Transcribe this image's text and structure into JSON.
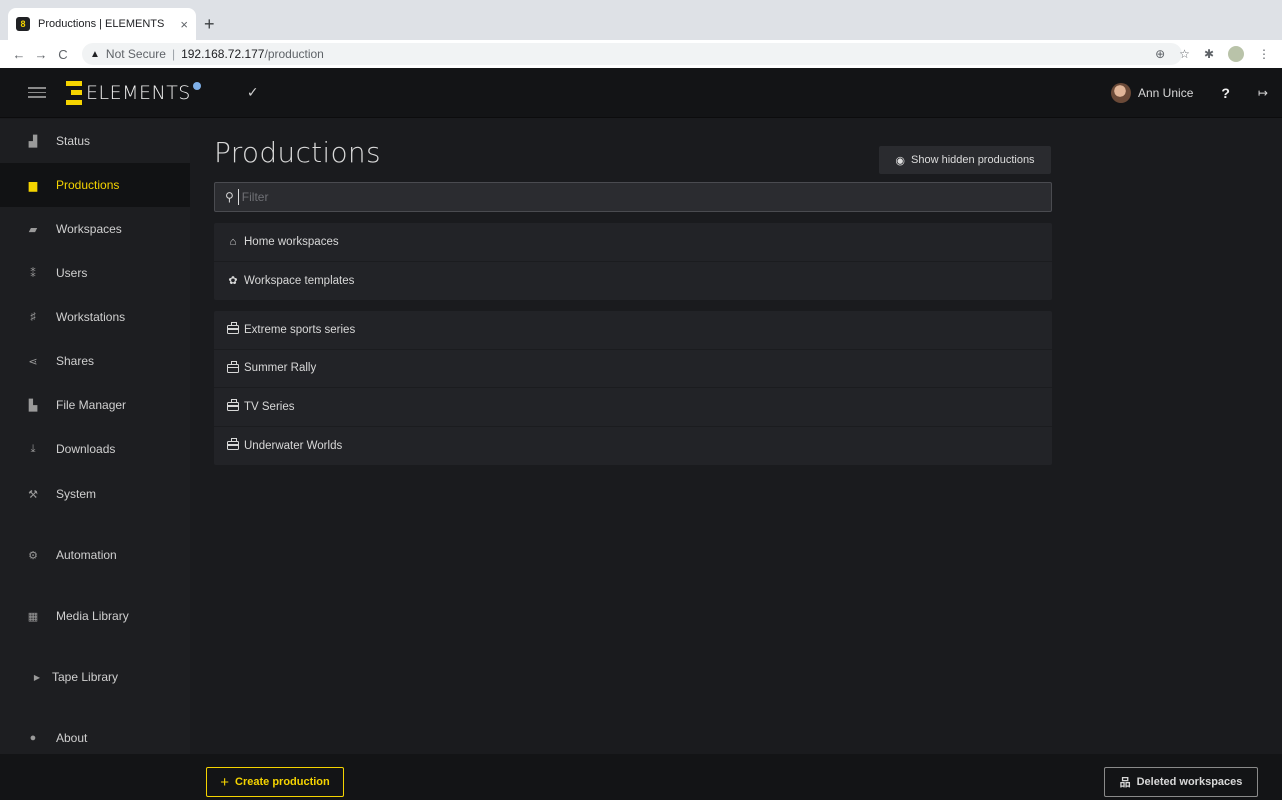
{
  "browser": {
    "tab_title": "Productions | ELEMENTS",
    "favicon_letter": "8",
    "close_glyph": "×",
    "newtab_glyph": "+",
    "back_glyph": "←",
    "forward_glyph": "→",
    "reload_glyph": "C",
    "security_warning": "▲",
    "security_label": "Not Secure",
    "url_host": "192.168.72.177",
    "url_path": "/production",
    "zoom_glyph": "⊕",
    "bookmark_glyph": "☆",
    "extensions_glyph": "✱",
    "menu_glyph": "⋮"
  },
  "header": {
    "logo_text": "ELEMENTS",
    "check_glyph": "✓",
    "user_name": "Ann Unice",
    "help_glyph": "?",
    "logout_glyph": "↦"
  },
  "sidebar": {
    "items": [
      {
        "label": "Status",
        "icon": "area-chart-icon",
        "glyph": "▟"
      },
      {
        "label": "Productions",
        "icon": "briefcase-icon",
        "glyph": "▆"
      },
      {
        "label": "Workspaces",
        "icon": "folder-open-icon",
        "glyph": "▰"
      },
      {
        "label": "Users",
        "icon": "users-icon",
        "glyph": "⁑"
      },
      {
        "label": "Workstations",
        "icon": "sitemap-icon",
        "glyph": "♯"
      },
      {
        "label": "Shares",
        "icon": "share-icon",
        "glyph": "⋖"
      },
      {
        "label": "File Manager",
        "icon": "folders-icon",
        "glyph": "▙"
      },
      {
        "label": "Downloads",
        "icon": "download-icon",
        "glyph": "⤓"
      },
      {
        "label": "System",
        "icon": "wrench-icon",
        "glyph": "⚒"
      },
      {
        "label": "Automation",
        "icon": "cogs-icon",
        "glyph": "⚙"
      },
      {
        "label": "Media Library",
        "icon": "film-icon",
        "glyph": "▦"
      },
      {
        "label": "Tape Library",
        "icon": "caret-right-icon",
        "glyph": "▶"
      },
      {
        "label": "About",
        "icon": "info-circle-icon",
        "glyph": "●"
      }
    ],
    "active": "Productions"
  },
  "main": {
    "title": "Productions",
    "show_hidden_label": "Show hidden productions",
    "eye_glyph": "◉",
    "search_glyph": "⚲",
    "filter_placeholder": "Filter",
    "special_items": [
      {
        "label": "Home workspaces",
        "icon": "home-icon",
        "glyph": "⌂"
      },
      {
        "label": "Workspace templates",
        "icon": "gear-icon",
        "glyph": "✿"
      }
    ],
    "productions": [
      {
        "label": "Extreme sports series",
        "icon": "briefcase-icon"
      },
      {
        "label": "Summer Rally",
        "icon": "briefcase-icon"
      },
      {
        "label": "TV Series",
        "icon": "briefcase-icon"
      },
      {
        "label": "Underwater Worlds",
        "icon": "briefcase-icon"
      }
    ]
  },
  "footer": {
    "create_label": "Create production",
    "create_glyph": "+",
    "deleted_label": "Deleted workspaces",
    "deleted_glyph": "品"
  },
  "colors": {
    "accent": "#f5d400",
    "background": "#1a1b1e",
    "sidebar": "#1d1e21",
    "header": "#131416",
    "panel": "#222327"
  }
}
